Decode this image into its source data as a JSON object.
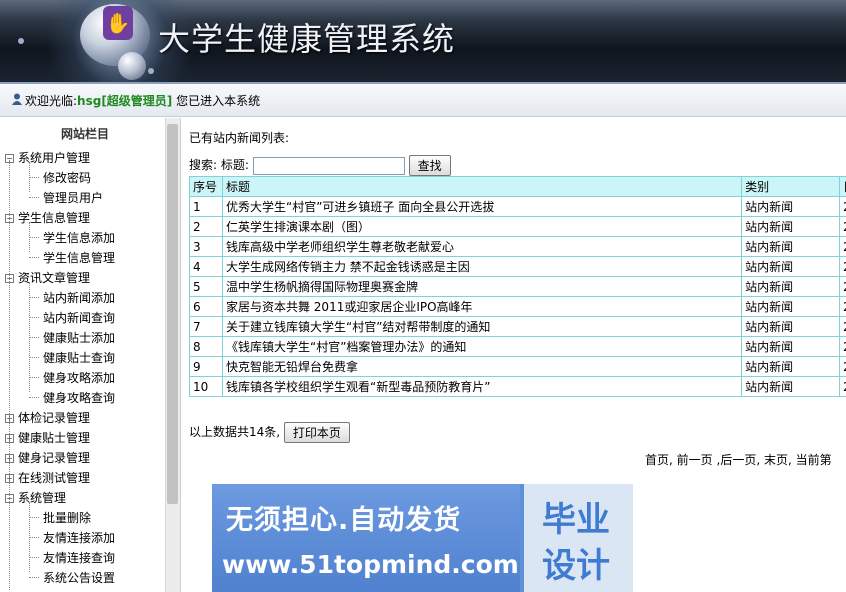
{
  "header": {
    "title": "大学生健康管理系统"
  },
  "welcome": {
    "prefix": "欢迎光临:",
    "user": "hsg[超级管理员]",
    "suffix": "您已进入本系统"
  },
  "sidebar": {
    "heading": "网站栏目",
    "groups": [
      {
        "label": "系统用户管理",
        "expanded": true,
        "items": [
          "修改密码",
          "管理员用户"
        ]
      },
      {
        "label": "学生信息管理",
        "expanded": true,
        "items": [
          "学生信息添加",
          "学生信息管理"
        ]
      },
      {
        "label": "资讯文章管理",
        "expanded": true,
        "items": [
          "站内新闻添加",
          "站内新闻查询",
          "健康贴士添加",
          "健康贴士查询",
          "健身攻略添加",
          "健身攻略查询"
        ]
      },
      {
        "label": "体检记录管理",
        "expanded": false,
        "items": []
      },
      {
        "label": "健康贴士管理",
        "expanded": false,
        "items": []
      },
      {
        "label": "健身记录管理",
        "expanded": false,
        "items": []
      },
      {
        "label": "在线测试管理",
        "expanded": false,
        "items": []
      },
      {
        "label": "系统管理",
        "expanded": true,
        "items": [
          "批量删除",
          "友情连接添加",
          "友情连接查询",
          "系统公告设置"
        ]
      }
    ]
  },
  "main": {
    "caption": "已有站内新闻列表:",
    "search_label": "搜索:",
    "title_label": "标题:",
    "search_value": "",
    "search_button": "查找",
    "columns": [
      "序号",
      "标题",
      "类别",
      "日"
    ],
    "rows": [
      [
        "1",
        "优秀大学生“村官”可进乡镇班子 面向全县公开选拔",
        "站内新闻",
        "2"
      ],
      [
        "2",
        "仁英学生排演课本剧（图）",
        "站内新闻",
        "2"
      ],
      [
        "3",
        "钱库高级中学老师组织学生尊老敬老献爱心",
        "站内新闻",
        "2"
      ],
      [
        "4",
        "大学生成网络传销主力 禁不起金钱诱惑是主因",
        "站内新闻",
        "2"
      ],
      [
        "5",
        "温中学生杨帆摘得国际物理奥赛金牌",
        "站内新闻",
        "2"
      ],
      [
        "6",
        "家居与资本共舞 2011或迎家居企业IPO高峰年",
        "站内新闻",
        "2"
      ],
      [
        "7",
        "关于建立钱库镇大学生“村官”结对帮带制度的通知",
        "站内新闻",
        "2"
      ],
      [
        "8",
        "《钱库镇大学生“村官”档案管理办法》的通知",
        "站内新闻",
        "2"
      ],
      [
        "9",
        "快克智能无铅焊台免费拿",
        "站内新闻",
        "2"
      ],
      [
        "10",
        "钱库镇各学校组织学生观看“新型毒品预防教育片”",
        "站内新闻",
        "2"
      ]
    ],
    "total_text": "以上数据共14条,",
    "print_button": "打印本页",
    "pager": [
      "首页",
      "前一页",
      "后一页",
      "末页",
      "当前第"
    ]
  },
  "banner": {
    "line1": "无须担心.自动发货",
    "line2": "www.51topmind.com",
    "badge_top": "毕业",
    "badge_bottom": "设计"
  }
}
